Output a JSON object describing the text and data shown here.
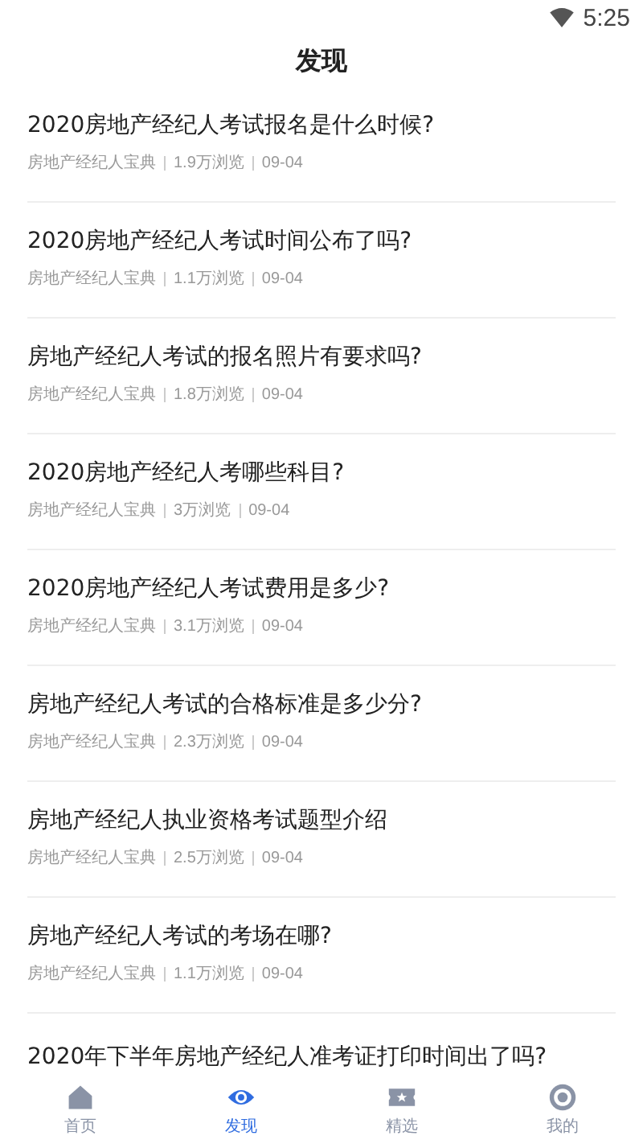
{
  "status_bar": {
    "time": "5:25"
  },
  "header": {
    "title": "发现"
  },
  "articles": [
    {
      "title": "2020房地产经纪人考试报名是什么时候?",
      "source": "房地产经纪人宝典",
      "views": "1.9万浏览",
      "date": "09-04"
    },
    {
      "title": "2020房地产经纪人考试时间公布了吗?",
      "source": "房地产经纪人宝典",
      "views": "1.1万浏览",
      "date": "09-04"
    },
    {
      "title": "房地产经纪人考试的报名照片有要求吗?",
      "source": "房地产经纪人宝典",
      "views": "1.8万浏览",
      "date": "09-04"
    },
    {
      "title": "2020房地产经纪人考哪些科目?",
      "source": "房地产经纪人宝典",
      "views": "3万浏览",
      "date": "09-04"
    },
    {
      "title": "2020房地产经纪人考试费用是多少?",
      "source": "房地产经纪人宝典",
      "views": "3.1万浏览",
      "date": "09-04"
    },
    {
      "title": "房地产经纪人考试的合格标准是多少分?",
      "source": "房地产经纪人宝典",
      "views": "2.3万浏览",
      "date": "09-04"
    },
    {
      "title": "房地产经纪人执业资格考试题型介绍",
      "source": "房地产经纪人宝典",
      "views": "2.5万浏览",
      "date": "09-04"
    },
    {
      "title": "房地产经纪人考试的考场在哪?",
      "source": "房地产经纪人宝典",
      "views": "1.1万浏览",
      "date": "09-04"
    },
    {
      "title": "2020年下半年房地产经纪人准考证打印时间出了吗?"
    }
  ],
  "tab_bar": [
    {
      "kind": "home",
      "label": "首页",
      "selected": false
    },
    {
      "kind": "discover",
      "label": "发现",
      "selected": true
    },
    {
      "kind": "featured",
      "label": "精选",
      "selected": false
    },
    {
      "kind": "profile",
      "label": "我的",
      "selected": false
    }
  ]
}
